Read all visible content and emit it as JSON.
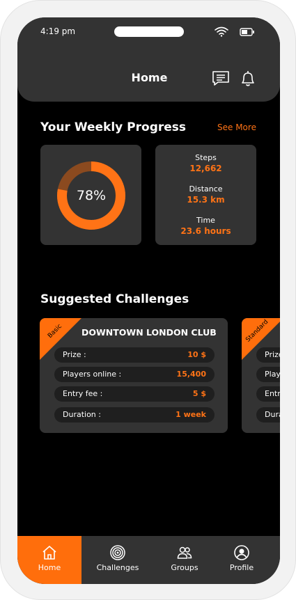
{
  "status": {
    "time": "4:19 pm"
  },
  "header": {
    "title": "Home",
    "messages_icon": "chat-icon",
    "notifications_icon": "bell-icon"
  },
  "progress": {
    "title": "Your Weekly Progress",
    "see_more": "See More",
    "percent": 78,
    "percent_label": "78%",
    "accent": "#ff7316",
    "track_color": "#8b4a1f",
    "stats": [
      {
        "label": "Steps",
        "value": "12,662"
      },
      {
        "label": "Distance",
        "value": "15.3 km"
      },
      {
        "label": "Time",
        "value": "23.6 hours"
      }
    ]
  },
  "challenges": {
    "title": "Suggested Challenges",
    "items": [
      {
        "tier": "Basic",
        "name": "DOWNTOWN LONDON CLUB",
        "rows": [
          {
            "label": "Prize :",
            "value": "10 $"
          },
          {
            "label": "Players online :",
            "value": "15,400"
          },
          {
            "label": "Entry fee :",
            "value": "5 $"
          },
          {
            "label": "Duration :",
            "value": "1 week"
          }
        ]
      },
      {
        "tier": "Standard",
        "name": "",
        "rows": [
          {
            "label": "Prize :",
            "value": ""
          },
          {
            "label": "Players online :",
            "value": ""
          },
          {
            "label": "Entry fee :",
            "value": ""
          },
          {
            "label": "Duration :",
            "value": ""
          }
        ]
      }
    ]
  },
  "nav": {
    "items": [
      {
        "label": "Home",
        "icon": "home-icon",
        "active": true
      },
      {
        "label": "Challenges",
        "icon": "target-icon",
        "active": false
      },
      {
        "label": "Groups",
        "icon": "groups-icon",
        "active": false
      },
      {
        "label": "Profile",
        "icon": "profile-icon",
        "active": false
      }
    ]
  }
}
